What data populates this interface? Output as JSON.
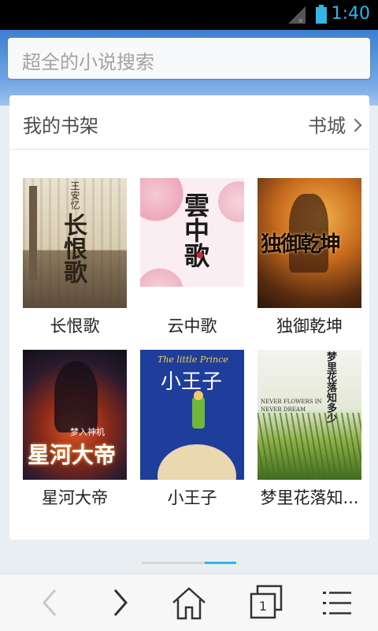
{
  "status": {
    "time": "1:40"
  },
  "search": {
    "placeholder": "超全的小说搜索"
  },
  "shelf": {
    "title": "我的书架",
    "store_link": "书城"
  },
  "books": [
    {
      "title": "长恨歌",
      "cover_author": "王安忆",
      "cover_title": "长恨歌"
    },
    {
      "title": "云中歌",
      "cover_title": "雲中歌"
    },
    {
      "title": "独御乾坤",
      "cover_title": "独御乾坤"
    },
    {
      "title": "星河大帝",
      "cover_title": "星河大帝",
      "cover_subtitle": "梦入神机"
    },
    {
      "title": "小王子",
      "cover_title": "小王子",
      "cover_subtitle": "The little Prince"
    },
    {
      "title": "梦里花落知...",
      "cover_title": "梦里花落知多少",
      "cover_subtitle": "NEVER FLOWERS IN NEVER DREAM"
    }
  ],
  "pager": {
    "page_count": 2,
    "active_index": 1
  },
  "colors": {
    "accent": "#33b5e5",
    "header_blue": "#4a88d6"
  },
  "bottom_nav": {
    "icons": [
      "back-icon",
      "forward-icon",
      "home-icon",
      "windows-icon",
      "menu-icon"
    ],
    "windows_count": "1"
  }
}
